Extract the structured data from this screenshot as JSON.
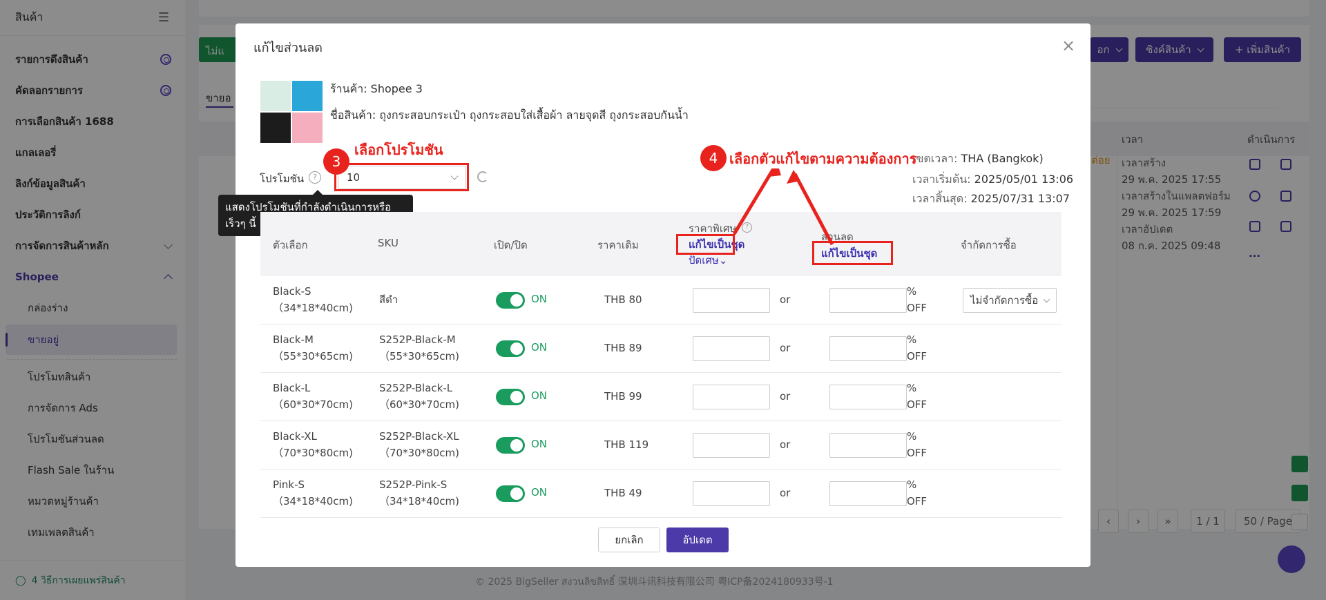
{
  "sidebar": {
    "title": "สินค้า",
    "items": [
      {
        "label": "รายการดึงสินค้า"
      },
      {
        "label": "คัดลอกรายการ"
      },
      {
        "label": "การเลือกสินค้า 1688"
      },
      {
        "label": "แกลเลอรี่"
      },
      {
        "label": "ลิงก์ข้อมูลสินค้า"
      },
      {
        "label": "ประวัติการลิงก์"
      },
      {
        "label": "การจัดการสินค้าหลัก"
      },
      {
        "label": "Shopee"
      }
    ],
    "subitems": [
      {
        "label": "กล่องร่าง"
      },
      {
        "label": "ขายอยู่"
      },
      {
        "label": "โปรโมทสินค้า"
      },
      {
        "label": "การจัดการ Ads"
      },
      {
        "label": "โปรโมชันส่วนลด"
      },
      {
        "label": "Flash Sale ในร้าน"
      },
      {
        "label": "หมวดหมู่ร้านค้า"
      },
      {
        "label": "เทมเพลตสินค้า"
      }
    ],
    "footer": "4 วิธีการเผยแพร่สินค้า"
  },
  "background": {
    "green_button": "ไม่แ",
    "tab_label": "ขายอ",
    "toolbar": {
      "more_label": "อก",
      "sync_label": "ซิงค์สินค้า",
      "add_label": "+ เพิ่มสินค้า"
    },
    "col_time": "เวลา",
    "col_action": "ดำเนินการ",
    "row_times": {
      "created_label": "เวลาสร้าง",
      "created_value": "29 พ.ค. 2025 17:55",
      "platform_label": "เวลาสร้างในแพลตฟอร์ม",
      "platform_value": "29 พ.ค. 2025 17:59",
      "updated_label": "เวลาอัปเดต",
      "updated_value": "08 ก.ค. 2025 09:48"
    },
    "orange_text": "ต่อย",
    "more_dots": "...",
    "pagination": {
      "page": "1 / 1",
      "page_size": "50 / Page"
    },
    "footer": "© 2025 BigSeller สงวนลิขสิทธิ์   深圳斗讯科技有限公司   粤ICP备2024180933号-1"
  },
  "modal": {
    "title": "แก้ไขส่วนลด",
    "close": "×",
    "store": "ร้านค้า: Shopee 3",
    "product_name": "ชื่อสินค้า: ถุงกระสอบกระเป๋า ถุงกระสอบใส่เสื้อผ้า ลายจุดสี ถุงกระสอบกันน้ำ",
    "promotion_label": "โปรโมชัน",
    "promotion_value": "10",
    "tooltip": "แสดงโปรโมชันที่กำลังดำเนินการหรือเร็วๆ นี้",
    "timezone_label": "เขตเวลา:",
    "timezone_value": "THA (Bangkok)",
    "start_label": "เวลาเริ่มต้น:",
    "start_value": "2025/05/01 13:06",
    "end_label": "เวลาสิ้นสุด:",
    "end_value": "2025/07/31 13:07",
    "annotations": {
      "step3_num": "3",
      "step3_text": "เลือกโปรโมชัน",
      "step4_num": "4",
      "step4_text": "เลือกตัวแก้ไขตามความต้องการ"
    },
    "table": {
      "headers": {
        "option": "ตัวเลือก",
        "sku": "SKU",
        "toggle": "เปิด/ปิด",
        "original_price": "ราคาเดิม",
        "special_price": "ราคาพิเศษ",
        "special_edit": "แก้ไขเป็นชุด",
        "special_round": "ปัดเศษ",
        "discount": "ส่วนลด",
        "discount_edit": "แก้ไขเป็นชุด",
        "purchase_limit": "จำกัดการซื้อ"
      },
      "or_text": "or",
      "off_text_1": "%",
      "off_text_2": "OFF",
      "on_text": "ON",
      "limit_value": "ไม่จำกัดการซื้อ",
      "rows": [
        {
          "option": "Black-S",
          "option_size": "（34*18*40cm)",
          "sku": "สีดำ",
          "sku_size": "",
          "price": "THB 80"
        },
        {
          "option": "Black-M",
          "option_size": "（55*30*65cm)",
          "sku": "S252P-Black-M",
          "sku_size": "（55*30*65cm)",
          "price": "THB 89"
        },
        {
          "option": "Black-L",
          "option_size": "（60*30*70cm)",
          "sku": "S252P-Black-L",
          "sku_size": "（60*30*70cm)",
          "price": "THB 99"
        },
        {
          "option": "Black-XL",
          "option_size": "（70*30*80cm)",
          "sku": "S252P-Black-XL",
          "sku_size": "（70*30*80cm)",
          "price": "THB 119"
        },
        {
          "option": "Pink-S",
          "option_size": "（34*18*40cm)",
          "sku": "S252P-Pink-S",
          "sku_size": "（34*18*40cm)",
          "price": "THB 49"
        }
      ]
    },
    "cancel": "ยกเลิก",
    "update": "อัปเดต"
  },
  "colors": {
    "primary": "#4c3aa8",
    "green": "#1a9c5e",
    "annotation": "#e8231d",
    "tooltip_bg": "#1f1f1f"
  }
}
